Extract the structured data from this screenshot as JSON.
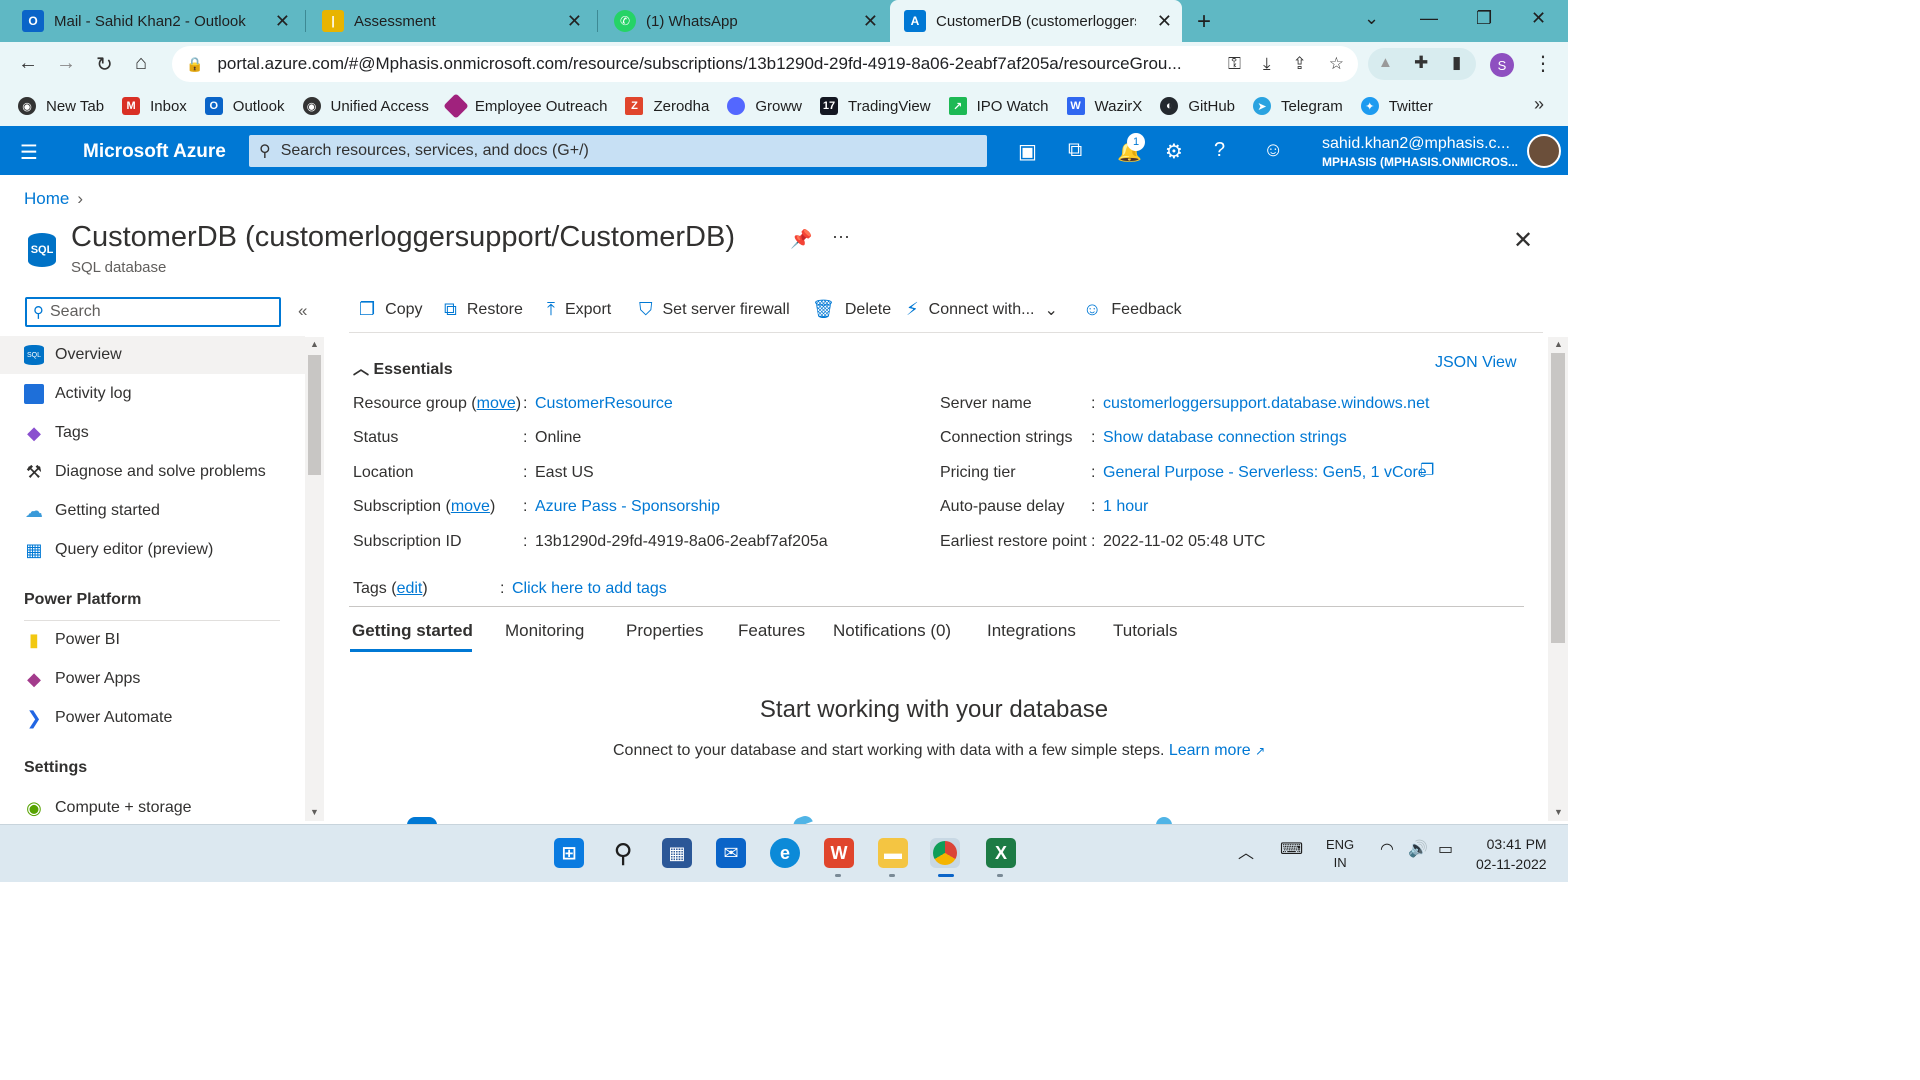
{
  "browser": {
    "tabs": [
      {
        "label": "Mail - Sahid Khan2 - Outlook",
        "icon": "outlook-icon",
        "color": "#0a64c8"
      },
      {
        "label": "Assessment",
        "icon": "assessment-icon",
        "color": "#e8b400"
      },
      {
        "label": "(1) WhatsApp",
        "icon": "whatsapp-icon",
        "color": "#25d366"
      },
      {
        "label": "CustomerDB (customerloggersup",
        "icon": "azure-icon",
        "color": "#0078d4"
      }
    ],
    "close_glyph": "✕",
    "new_tab_glyph": "+",
    "url": "portal.azure.com/#@Mphasis.onmicrosoft.com/resource/subscriptions/13b1290d-29fd-4919-8a06-2eabf7af205a/resourceGrou...",
    "profile_initial": "S",
    "bookmarks": [
      {
        "label": "New Tab",
        "color": "#333333"
      },
      {
        "label": "Inbox",
        "color": "#d93025"
      },
      {
        "label": "Outlook",
        "color": "#0a64c8"
      },
      {
        "label": "Unified Access",
        "color": "#333333"
      },
      {
        "label": "Employee Outreach",
        "color": "#a0227d"
      },
      {
        "label": "Zerodha",
        "color": "#e0452c"
      },
      {
        "label": "Groww",
        "color": "#5367ff"
      },
      {
        "label": "TradingView",
        "color": "#131722"
      },
      {
        "label": "IPO Watch",
        "color": "#1db954"
      },
      {
        "label": "WazirX",
        "color": "#3067f0"
      },
      {
        "label": "GitHub",
        "color": "#24292e"
      },
      {
        "label": "Telegram",
        "color": "#2aa3e0"
      },
      {
        "label": "Twitter",
        "color": "#1d9bf0"
      }
    ]
  },
  "azure": {
    "brand": "Microsoft Azure",
    "search_placeholder": "Search resources, services, and docs (G+/)",
    "notification_count": "1",
    "account_email": "sahid.khan2@mphasis.c...",
    "account_tenant": "MPHASIS (MPHASIS.ONMICROS..."
  },
  "page": {
    "breadcrumb_home": "Home",
    "resource_icon_text": "SQL",
    "title": "CustomerDB (customerloggersupport/CustomerDB)",
    "subtitle": "SQL database",
    "nav_search_placeholder": "Search",
    "nav_items": [
      {
        "label": "Overview",
        "icon": "sql-overview-icon"
      },
      {
        "label": "Activity log",
        "icon": "activity-log-icon"
      },
      {
        "label": "Tags",
        "icon": "tags-icon"
      },
      {
        "label": "Diagnose and solve problems",
        "icon": "wrench-icon"
      },
      {
        "label": "Getting started",
        "icon": "cloud-icon"
      },
      {
        "label": "Query editor (preview)",
        "icon": "query-editor-icon"
      }
    ],
    "section_power": "Power Platform",
    "power_items": [
      {
        "label": "Power BI",
        "icon": "power-bi-icon"
      },
      {
        "label": "Power Apps",
        "icon": "power-apps-icon"
      },
      {
        "label": "Power Automate",
        "icon": "power-automate-icon"
      }
    ],
    "section_settings": "Settings",
    "settings_items": [
      {
        "label": "Compute + storage",
        "icon": "compute-storage-icon"
      }
    ],
    "commands": [
      {
        "label": "Copy",
        "icon": "copy-icon"
      },
      {
        "label": "Restore",
        "icon": "restore-icon"
      },
      {
        "label": "Export",
        "icon": "export-icon"
      },
      {
        "label": "Set server firewall",
        "icon": "shield-icon"
      },
      {
        "label": "Delete",
        "icon": "trash-icon"
      },
      {
        "label": "Connect with...",
        "icon": "plug-icon"
      },
      {
        "label": "Feedback",
        "icon": "feedback-icon"
      }
    ],
    "essentials": {
      "heading": "Essentials",
      "json_view": "JSON View",
      "left": {
        "rg_label": "Resource group",
        "move": "move",
        "rg_value": "CustomerResource",
        "status_label": "Status",
        "status_value": "Online",
        "location_label": "Location",
        "location_value": "East US",
        "sub_label": "Subscription",
        "sub_value": "Azure Pass - Sponsorship",
        "subid_label": "Subscription ID",
        "subid_value": "13b1290d-29fd-4919-8a06-2eabf7af205a"
      },
      "right": {
        "server_label": "Server name",
        "server_value": "customerloggersupport.database.windows.net",
        "conn_label": "Connection strings",
        "conn_value": "Show database connection strings",
        "pricing_label": "Pricing tier",
        "pricing_value": "General Purpose - Serverless: Gen5, 1 vCore",
        "autopause_label": "Auto-pause delay",
        "autopause_value": "1 hour",
        "restore_label": "Earliest restore point",
        "restore_value": "2022-11-02 05:48 UTC"
      },
      "tags_label": "Tags",
      "tags_edit": "edit",
      "tags_value": "Click here to add tags"
    },
    "tabs": [
      "Getting started",
      "Monitoring",
      "Properties",
      "Features",
      "Notifications (0)",
      "Integrations",
      "Tutorials"
    ],
    "getting_started_title": "Start working with your database",
    "getting_started_desc": "Connect to your database and start working with data with a few simple steps.",
    "learn_more": "Learn more"
  },
  "taskbar": {
    "lang_line1": "ENG",
    "lang_line2": "IN",
    "time": "03:41 PM",
    "date": "02-11-2022"
  }
}
